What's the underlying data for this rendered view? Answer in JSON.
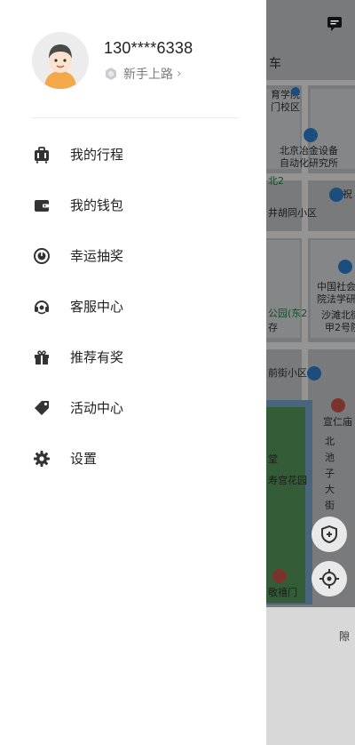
{
  "user": {
    "phone": "130****6338",
    "level": "新手上路",
    "level_arrow": "›"
  },
  "menu": {
    "items": [
      {
        "label": "我的行程",
        "icon": "luggage-icon"
      },
      {
        "label": "我的钱包",
        "icon": "wallet-icon"
      },
      {
        "label": "幸运抽奖",
        "icon": "lucky-draw-icon"
      },
      {
        "label": "客服中心",
        "icon": "customer-service-icon"
      },
      {
        "label": "推荐有奖",
        "icon": "gift-icon"
      },
      {
        "label": "活动中心",
        "icon": "tag-icon"
      },
      {
        "label": "设置",
        "icon": "gear-icon"
      }
    ]
  },
  "map": {
    "labels": [
      {
        "text": "车"
      },
      {
        "text": "育学院"
      },
      {
        "text": "门校区"
      },
      {
        "text": "北京冶金设备"
      },
      {
        "text": "自动化研究所"
      },
      {
        "text": "北2"
      },
      {
        "text": "崇祝"
      },
      {
        "text": "井胡同小区"
      },
      {
        "text": "中国社会"
      },
      {
        "text": "院法学研"
      },
      {
        "text": "公园(东2"
      },
      {
        "text": "沙滩北街"
      },
      {
        "text": "甲2号院"
      },
      {
        "text": "存"
      },
      {
        "text": "前街小区"
      },
      {
        "text": "宣仁庙"
      },
      {
        "text": "北"
      },
      {
        "text": "池"
      },
      {
        "text": "子"
      },
      {
        "text": "大"
      },
      {
        "text": "街"
      },
      {
        "text": "堂"
      },
      {
        "text": "寿宫花园"
      },
      {
        "text": "敬禧门"
      },
      {
        "text": "隙"
      }
    ]
  },
  "colors": {
    "drawer_bg": "#ffffff",
    "icon_color": "#333333",
    "text_primary": "#222222",
    "text_secondary": "#7a7a7a"
  }
}
